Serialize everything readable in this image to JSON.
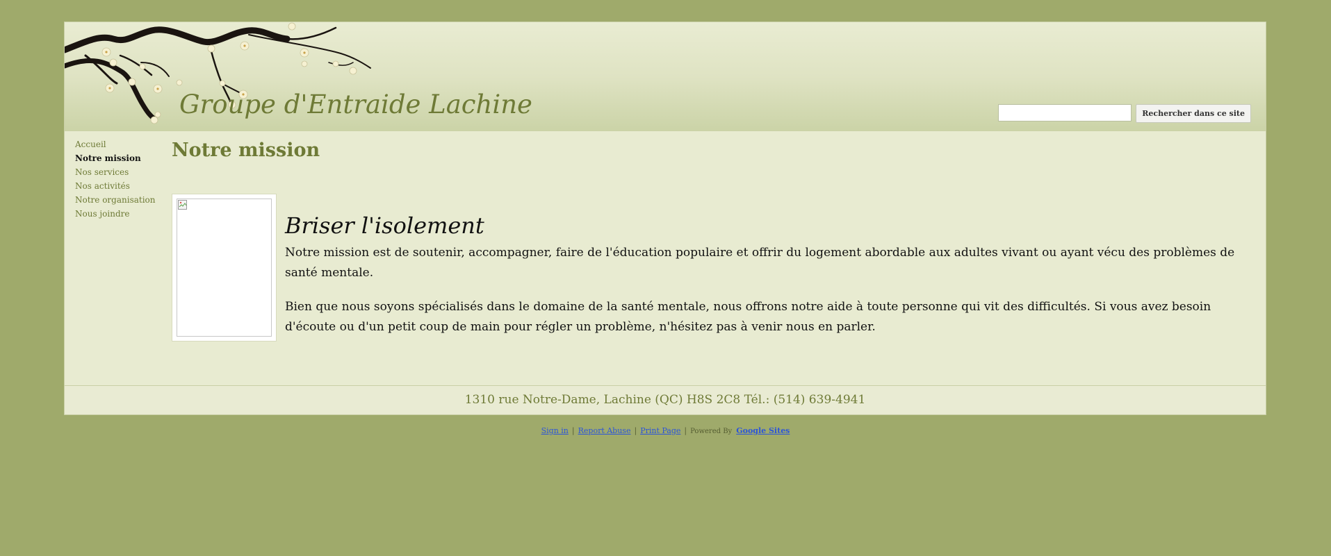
{
  "header": {
    "site_title": "Groupe d'Entraide Lachine",
    "search_placeholder": "",
    "search_button": "Rechercher dans ce site"
  },
  "sidebar": {
    "items": [
      {
        "label": "Accueil",
        "active": false
      },
      {
        "label": "Notre mission",
        "active": true
      },
      {
        "label": "Nos services",
        "active": false
      },
      {
        "label": "Nos activités",
        "active": false
      },
      {
        "label": "Notre organisation",
        "active": false
      },
      {
        "label": "Nous joindre",
        "active": false
      }
    ]
  },
  "main": {
    "page_title": "Notre mission",
    "heading": "Briser l'isolement",
    "paragraphs": [
      "Notre mission est de soutenir, accompagner, faire de l'éducation populaire et offrir du logement abordable aux adultes vivant ou ayant vécu des problèmes de santé mentale.",
      "Bien que nous soyons spécialisés dans le domaine de la santé mentale, nous offrons notre aide à toute personne qui vit des difficultés. Si vous avez besoin d'écoute ou d'un petit coup de main pour régler un problème, n'hésitez pas à venir nous en parler."
    ]
  },
  "footer": {
    "address": "1310 rue Notre-Dame, Lachine (QC) H8S 2C8 Tél.: (514) 639-4941"
  },
  "bottom_links": {
    "sign_in": "Sign in",
    "report_abuse": "Report Abuse",
    "print_page": "Print Page",
    "powered_by": "Powered By",
    "google_sites": "Google Sites",
    "separator": "|"
  },
  "colors": {
    "background": "#9faa6b",
    "page": "#e8ebd1",
    "accent": "#6e7a36",
    "link": "#2c55d8"
  }
}
